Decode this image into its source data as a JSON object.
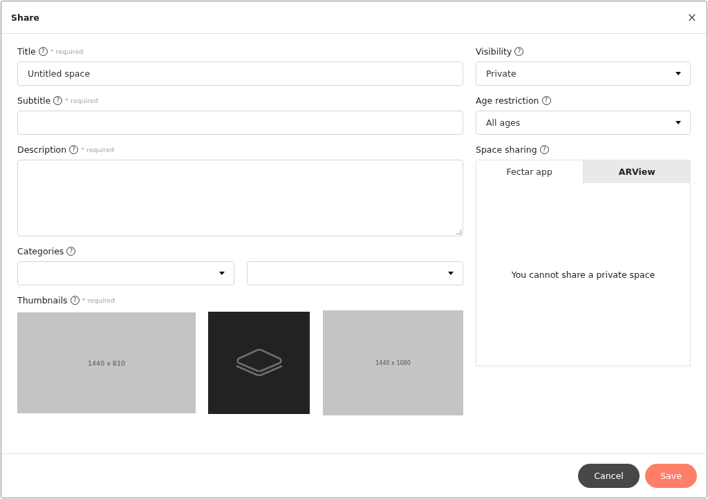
{
  "dialog": {
    "title": "Share",
    "close": "×"
  },
  "left": [
    {
      "kind": "text",
      "label": "Title",
      "help": "?",
      "note": "* required",
      "value": "Untitled space"
    },
    {
      "kind": "text",
      "label": "Subtitle",
      "help": "?",
      "note": "* required"
    },
    {
      "kind": "textarea",
      "label": "Description",
      "help": "?",
      "note": "* required"
    },
    {
      "kind": "select_pair",
      "label": "Categories",
      "help": "?"
    },
    {
      "kind": "thumbnails",
      "label": "Thumbnails",
      "help": "?",
      "note": "* required",
      "thumbnails": [
        {
          "kind": "placeholder",
          "text": "1440 x 810"
        },
        {
          "kind": "layers"
        },
        {
          "kind": "placeholder",
          "text": "1440 x 1080"
        }
      ]
    }
  ],
  "right": [
    {
      "kind": "select",
      "label": "Visibility",
      "help": "?",
      "value": "Private"
    },
    {
      "kind": "select",
      "label": "Age restriction",
      "help": "?",
      "value": "All ages"
    },
    {
      "kind": "tabs",
      "label": "Space sharing",
      "help": "?",
      "tabs": [
        {
          "label": "Fectar app",
          "selected": true
        },
        {
          "label": "ARView",
          "selected": false
        }
      ],
      "message": "You cannot share a private space"
    }
  ],
  "buttons": [
    {
      "label": "Cancel",
      "kind": "secondary"
    },
    {
      "label": "Save",
      "kind": "primary"
    }
  ]
}
